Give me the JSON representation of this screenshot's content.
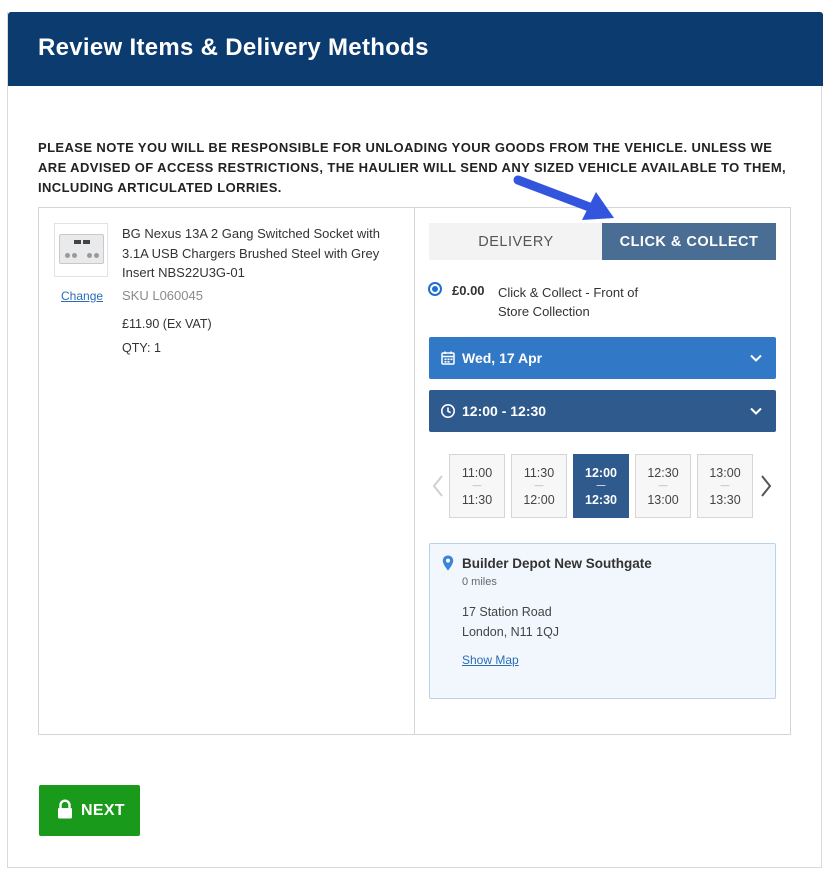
{
  "header": {
    "title": "Review Items & Delivery Methods"
  },
  "notice": "PLEASE NOTE YOU WILL BE RESPONSIBLE FOR UNLOADING YOUR GOODS FROM THE VEHICLE. UNLESS WE ARE ADVISED OF ACCESS RESTRICTIONS, THE HAULIER WILL SEND ANY SIZED VEHICLE AVAILABLE TO THEM, INCLUDING ARTICULATED LORRIES.",
  "product": {
    "name": "BG Nexus 13A 2 Gang Switched Socket with 3.1A USB Chargers Brushed Steel with Grey Insert NBS22U3G-01",
    "change_label": "Change",
    "sku": "SKU L060045",
    "price": "£11.90 (Ex VAT)",
    "qty": "QTY: 1"
  },
  "tabs": {
    "delivery": "DELIVERY",
    "click_collect": "CLICK & COLLECT",
    "active": "click_collect"
  },
  "option": {
    "price": "£0.00",
    "label": "Click & Collect - Front of Store Collection",
    "selected": true
  },
  "date_dropdown": {
    "value": "Wed, 17 Apr",
    "icon": "calendar-icon"
  },
  "time_dropdown": {
    "value": "12:00 - 12:30",
    "icon": "clock-icon"
  },
  "slots": [
    {
      "start": "11:00",
      "sep": "—",
      "end": "11:30",
      "selected": false
    },
    {
      "start": "11:30",
      "sep": "—",
      "end": "12:00",
      "selected": false
    },
    {
      "start": "12:00",
      "sep": "—",
      "end": "12:30",
      "selected": true
    },
    {
      "start": "12:30",
      "sep": "—",
      "end": "13:00",
      "selected": false
    },
    {
      "start": "13:00",
      "sep": "—",
      "end": "13:30",
      "selected": false
    }
  ],
  "store": {
    "name": "Builder Depot New Southgate",
    "distance": "0 miles",
    "address_line1": "17 Station Road",
    "address_line2": "London, N11 1QJ",
    "map_link": "Show Map"
  },
  "next_button": {
    "label": "NEXT"
  },
  "colors": {
    "header": "#0b3b6f",
    "tab_active": "#4a6d93",
    "date_dropdown": "#3178c6",
    "time_dropdown": "#2e5a8e",
    "next_button": "#1a9a1a",
    "annotation_arrow": "#3355dd"
  }
}
